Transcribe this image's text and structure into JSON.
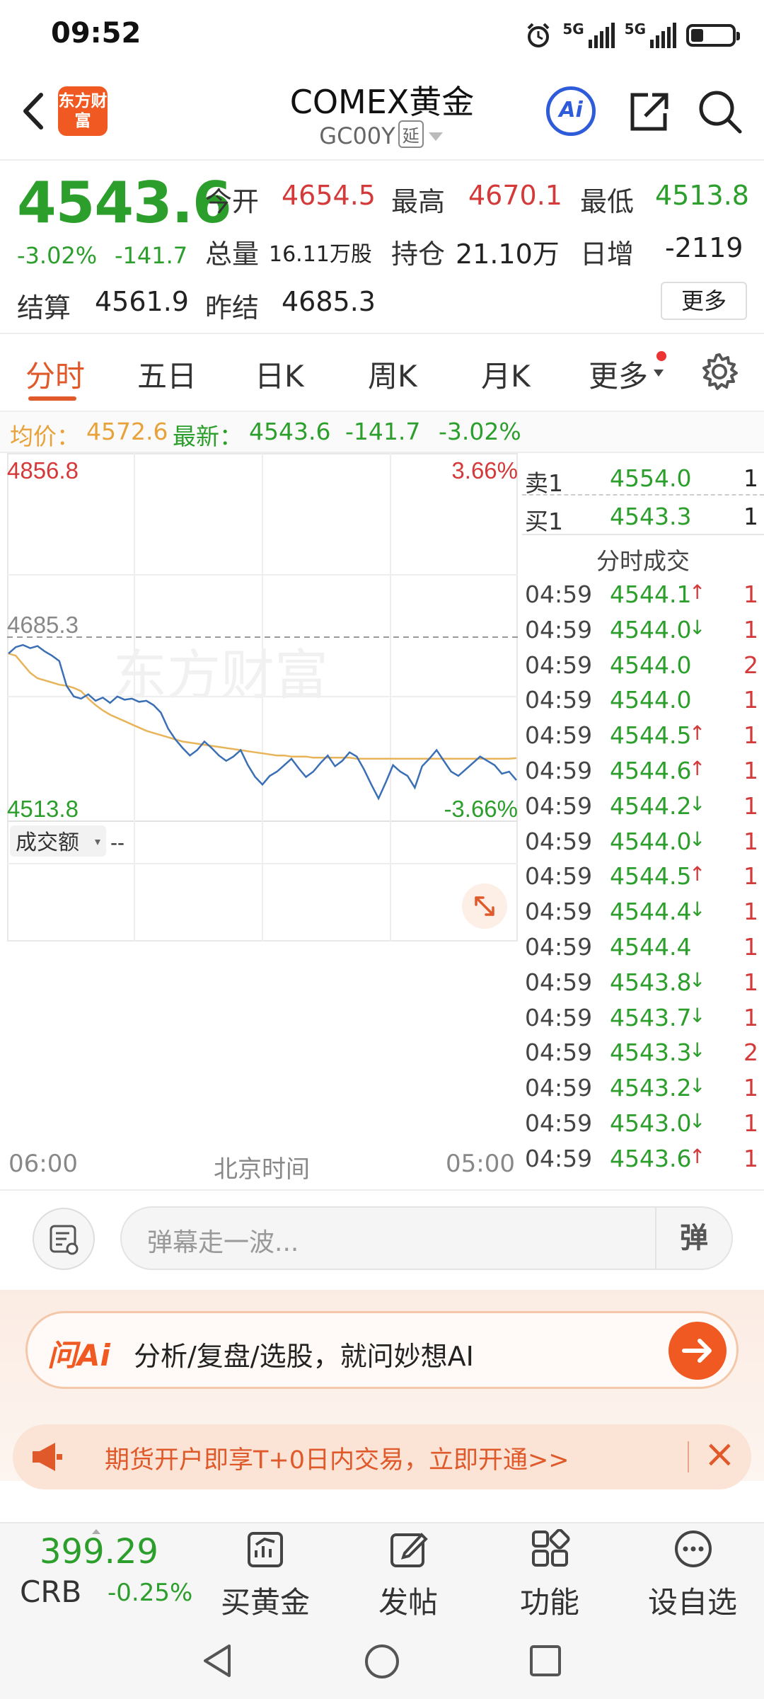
{
  "status_bar": {
    "time": "09:52",
    "network_1": "5G",
    "network_2": "5G"
  },
  "header": {
    "logo_text": "东方财富",
    "title": "COMEX黄金",
    "code": "GC00Y",
    "delay_tag": "延",
    "ai_label": "Ai"
  },
  "quote": {
    "price": "4543.6",
    "change_pct": "-3.02%",
    "change": "-141.7",
    "open_label": "今开",
    "open": "4654.5",
    "high_label": "最高",
    "high": "4670.1",
    "low_label": "最低",
    "low": "4513.8",
    "volume_label": "总量",
    "volume": "16.11万股",
    "position_label": "持仓",
    "position": "21.10万",
    "daily_inc_label": "日增",
    "daily_inc": "-2119",
    "settle_label": "结算",
    "settle": "4561.9",
    "prev_settle_label": "昨结",
    "prev_settle": "4685.3",
    "more_label": "更多"
  },
  "tabs": [
    "分时",
    "五日",
    "日K",
    "周K",
    "月K",
    "更多"
  ],
  "info_row": {
    "avg_label": "均价：",
    "avg": "4572.6",
    "latest_label": "最新：",
    "latest": "4543.6",
    "change": "-141.7",
    "change_pct": "-3.02%"
  },
  "chart_data": {
    "type": "line",
    "y_max_label": "4856.8",
    "y_max_pct": "3.66%",
    "y_ref_label": "4685.3",
    "y_min_label": "4513.8",
    "y_min_pct": "-3.66%",
    "ylim": [
      4513.8,
      4856.8
    ],
    "reference": 4685.3,
    "watermark": "东方财富",
    "x_start": "06:00",
    "x_mid": "北京时间",
    "x_end": "05:00",
    "volume_label": "成交额",
    "volume_value": "--",
    "series": [
      {
        "values": [
          4670,
          4676,
          4678,
          4675,
          4677,
          4672,
          4668,
          4663,
          4640,
          4630,
          4628,
          4632,
          4626,
          4629,
          4624,
          4630,
          4627,
          4628,
          4625,
          4626,
          4622,
          4615,
          4600,
          4590,
          4582,
          4575,
          4580,
          4588,
          4582,
          4575,
          4570,
          4574,
          4580,
          4566,
          4555,
          4548,
          4556,
          4560,
          4566,
          4572,
          4563,
          4555,
          4560,
          4568,
          4575,
          4565,
          4570,
          4578,
          4574,
          4562,
          4548,
          4535,
          4550,
          4566,
          4560,
          4556,
          4545,
          4565,
          4572,
          4580,
          4570,
          4560,
          4556,
          4562,
          4568,
          4574,
          4570,
          4566,
          4558,
          4560,
          4552
        ]
      },
      {
        "values": [
          4670,
          4668,
          4660,
          4652,
          4647,
          4645,
          4643,
          4641,
          4640,
          4638,
          4635,
          4628,
          4622,
          4617,
          4613,
          4610,
          4607,
          4604,
          4601,
          4598,
          4596,
          4594,
          4592,
          4590,
          4588,
          4587,
          4586,
          4585,
          4584,
          4583,
          4582,
          4581,
          4580,
          4579,
          4578,
          4577,
          4576,
          4575,
          4575,
          4574,
          4574,
          4574,
          4573,
          4573,
          4573,
          4573,
          4573,
          4573,
          4572,
          4572,
          4572,
          4572,
          4572,
          4572,
          4572,
          4572,
          4572,
          4572,
          4572,
          4572,
          4572,
          4572,
          4572,
          4572,
          4572,
          4572,
          4572,
          4572,
          4572,
          4572,
          4572.6
        ]
      }
    ]
  },
  "order_book": {
    "ask_label": "卖1",
    "ask_price": "4554.0",
    "ask_qty": "1",
    "bid_label": "买1",
    "bid_price": "4543.3",
    "bid_qty": "1",
    "trades_title": "分时成交",
    "trades": [
      {
        "time": "04:59",
        "price": "4544.1",
        "dir": "↑",
        "qty": "1"
      },
      {
        "time": "04:59",
        "price": "4544.0",
        "dir": "↓",
        "qty": "1"
      },
      {
        "time": "04:59",
        "price": "4544.0",
        "dir": "",
        "qty": "2"
      },
      {
        "time": "04:59",
        "price": "4544.0",
        "dir": "",
        "qty": "1"
      },
      {
        "time": "04:59",
        "price": "4544.5",
        "dir": "↑",
        "qty": "1"
      },
      {
        "time": "04:59",
        "price": "4544.6",
        "dir": "↑",
        "qty": "1"
      },
      {
        "time": "04:59",
        "price": "4544.2",
        "dir": "↓",
        "qty": "1"
      },
      {
        "time": "04:59",
        "price": "4544.0",
        "dir": "↓",
        "qty": "1"
      },
      {
        "time": "04:59",
        "price": "4544.5",
        "dir": "↑",
        "qty": "1"
      },
      {
        "time": "04:59",
        "price": "4544.4",
        "dir": "↓",
        "qty": "1"
      },
      {
        "time": "04:59",
        "price": "4544.4",
        "dir": "",
        "qty": "1"
      },
      {
        "time": "04:59",
        "price": "4543.8",
        "dir": "↓",
        "qty": "1"
      },
      {
        "time": "04:59",
        "price": "4543.7",
        "dir": "↓",
        "qty": "1"
      },
      {
        "time": "04:59",
        "price": "4543.3",
        "dir": "↓",
        "qty": "2"
      },
      {
        "time": "04:59",
        "price": "4543.2",
        "dir": "↓",
        "qty": "1"
      },
      {
        "time": "04:59",
        "price": "4543.0",
        "dir": "↓",
        "qty": "1"
      },
      {
        "time": "04:59",
        "price": "4543.6",
        "dir": "↑",
        "qty": "1"
      }
    ]
  },
  "danmu": {
    "placeholder": "弹幕走一波...",
    "send_label": "弹"
  },
  "ai_bar": {
    "brand": "问Ai",
    "text": "分析/复盘/选股，就问妙想AI"
  },
  "promo": {
    "text": "期货开户即享T+0日内交易，立即开通>>"
  },
  "bottom_nav": {
    "index_value": "399.29",
    "index_name": "CRB",
    "index_pct": "-0.25%",
    "items": [
      "买黄金",
      "发帖",
      "功能",
      "设自选"
    ]
  },
  "colors": {
    "up": "#d43a3a",
    "down": "#2c9e2c",
    "accent": "#e0592a",
    "avg_line": "#e8a23a",
    "price_line": "#3a6fb5"
  }
}
